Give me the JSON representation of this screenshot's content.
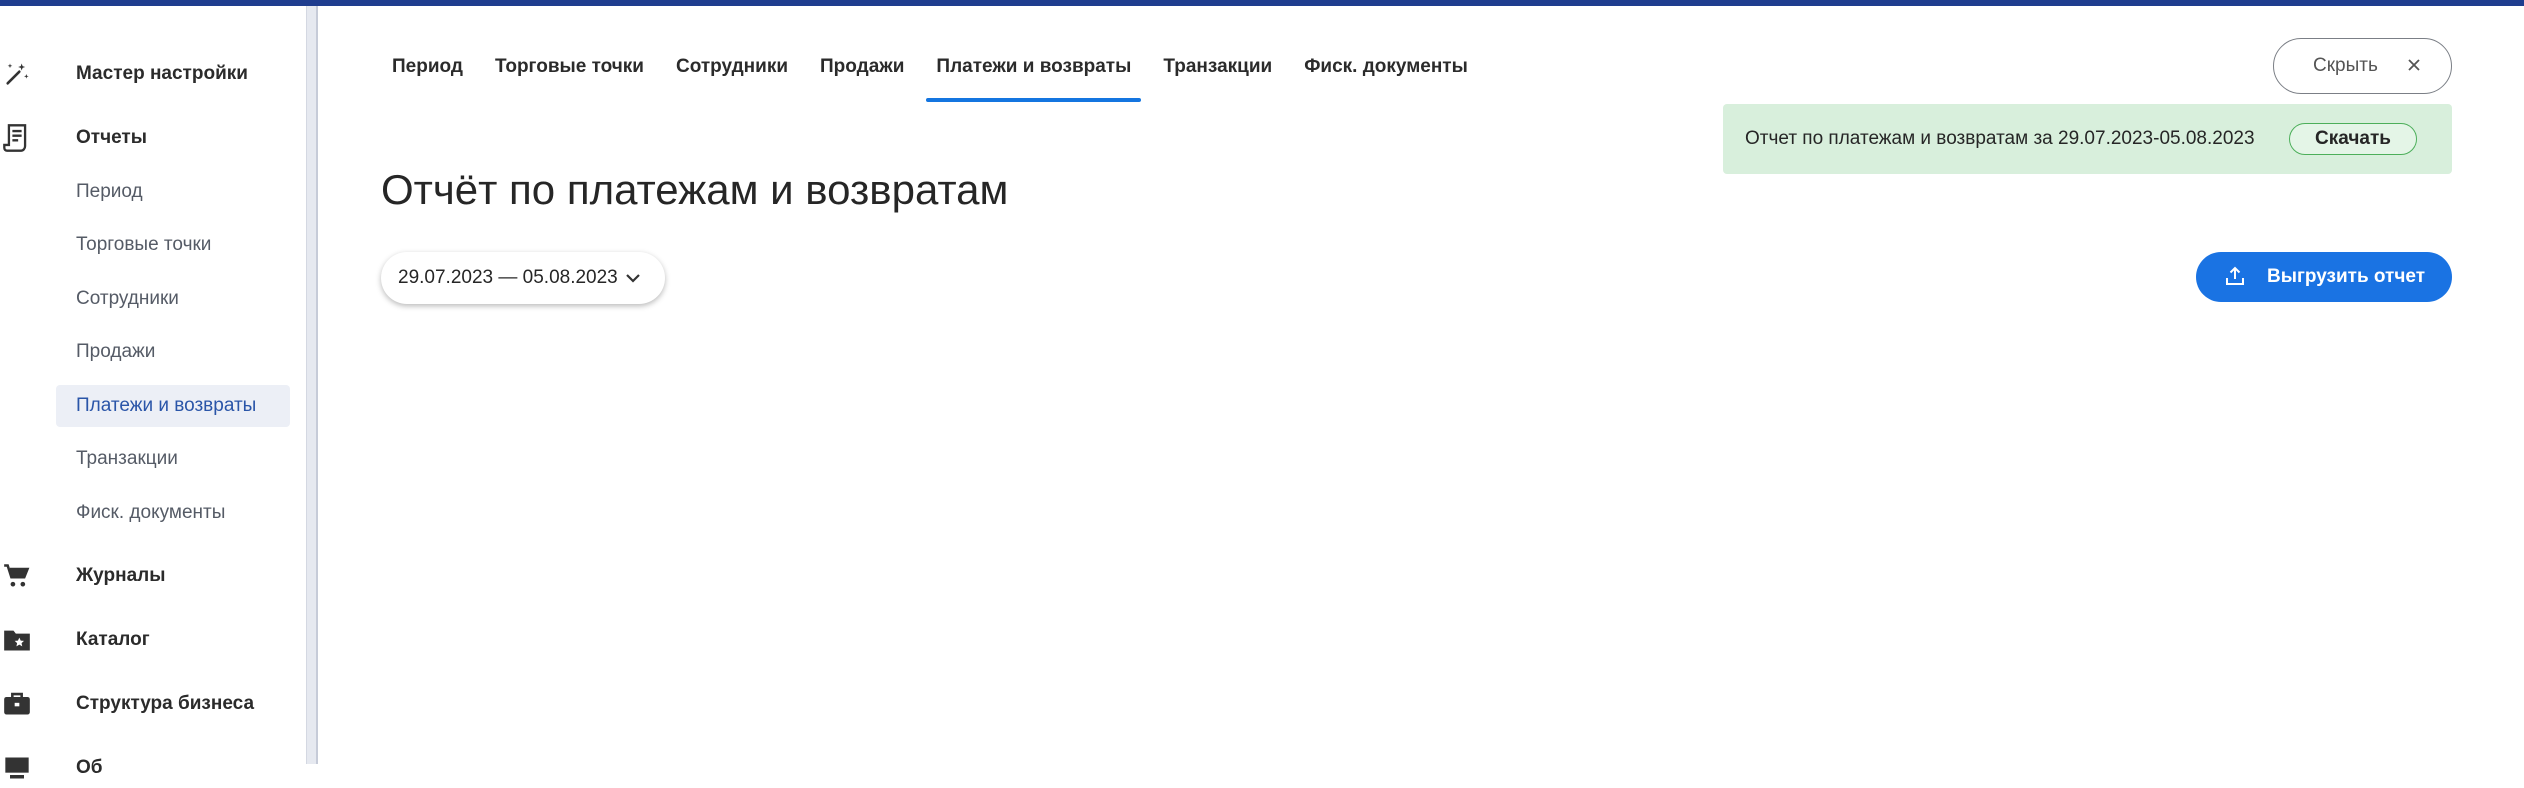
{
  "sidebar": {
    "items": [
      {
        "label": "Мастер настройки",
        "icon": "magic-wand-icon"
      },
      {
        "label": "Отчеты",
        "icon": "receipt-icon"
      },
      {
        "label": "Журналы",
        "icon": "shopping-cart-icon"
      },
      {
        "label": "Каталог",
        "icon": "folder-star-icon"
      },
      {
        "label": "Структура бизнеса",
        "icon": "briefcase-icon"
      },
      {
        "label": "Об",
        "icon": "monitor-icon"
      }
    ],
    "reports_subitems": [
      {
        "label": "Период"
      },
      {
        "label": "Торговые точки"
      },
      {
        "label": "Сотрудники"
      },
      {
        "label": "Продажи"
      },
      {
        "label": "Платежи и возвраты",
        "active": true
      },
      {
        "label": "Транзакции"
      },
      {
        "label": "Фиск. документы"
      }
    ]
  },
  "tabs": [
    {
      "label": "Период"
    },
    {
      "label": "Торговые точки"
    },
    {
      "label": "Сотрудники"
    },
    {
      "label": "Продажи"
    },
    {
      "label": "Платежи и возвраты",
      "active": true
    },
    {
      "label": "Транзакции"
    },
    {
      "label": "Фиск. документы"
    }
  ],
  "page": {
    "title": "Отчёт по платежам и возвратам",
    "date_range": "29.07.2023 — 05.08.2023"
  },
  "hide_button": {
    "label": "Скрыть"
  },
  "notice": {
    "text": "Отчет по платежам и возвратам за 29.07.2023-05.08.2023",
    "download_label": "Скачать"
  },
  "export_button": {
    "label": "Выгрузить отчет"
  },
  "colors": {
    "accent": "#1a73e3",
    "active_tab_underline": "#1475e0",
    "top_bar": "#1f3d8f",
    "notice_bg": "#d8efdc",
    "active_nav_bg": "#eceff6",
    "active_nav_text": "#2a55a8"
  }
}
